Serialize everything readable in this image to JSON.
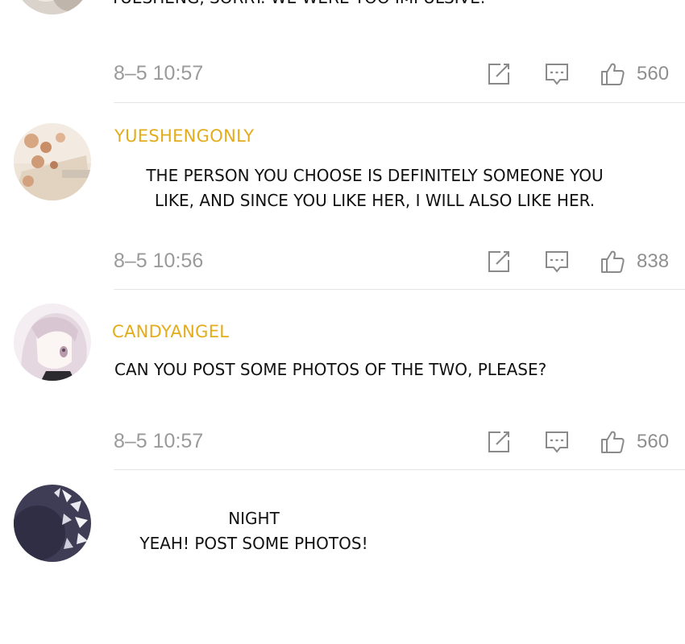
{
  "comments": [
    {
      "top_text": "YUESHENG, SORRY. WE WERE TOO IMPULSIVE.",
      "timestamp": "8–5 10:57",
      "likes": "560",
      "icons": [
        "edit-icon",
        "reply-icon",
        "thumbs-up-icon"
      ]
    },
    {
      "username": "YUESHENGONLY",
      "text_lines": [
        "THE PERSON YOU CHOOSE IS DEFINITELY SOMEONE YOU",
        "LIKE, AND SINCE YOU LIKE HER, I WILL ALSO LIKE HER."
      ],
      "timestamp": "8–5 10:56",
      "likes": "838",
      "icons": [
        "edit-icon",
        "reply-icon",
        "thumbs-up-icon"
      ]
    },
    {
      "username": "CANDYANGEL",
      "text_lines": [
        "CAN YOU POST SOME PHOTOS OF THE TWO, PLEASE?"
      ],
      "timestamp": "8–5 10:57",
      "likes": "560",
      "icons": [
        "edit-icon",
        "reply-icon",
        "thumbs-up-icon"
      ]
    },
    {
      "username": "NIGHT",
      "text_lines": [
        "YEAH! POST SOME PHOTOS!"
      ]
    }
  ],
  "colors": {
    "username": "#e3ac1b",
    "text": "#111111",
    "timestamp": "#9a9a9a",
    "icon": "#8a8a8a",
    "divider": "#e6e6e6"
  }
}
